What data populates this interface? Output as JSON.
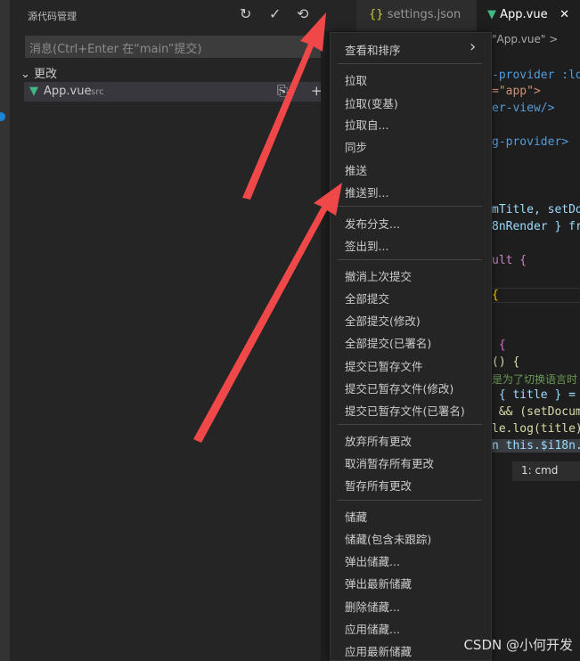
{
  "sidebar": {
    "title": "源代码管理",
    "message_placeholder": "消息(Ctrl+Enter 在“main”提交)",
    "changes_label": "更改",
    "file": {
      "name": "App.vue",
      "dir": "src"
    }
  },
  "tabs": [
    {
      "label": "settings.json",
      "icon": "{}"
    },
    {
      "label": "App.vue",
      "close": "✕"
    }
  ],
  "editor": {
    "breadcrumb": "\"App.vue\" >",
    "lines": [
      "-provider :lo",
      "=\"app\">",
      "er-view/>",
      "g-provider>",
      "mTitle, setDo",
      "8nRender } fr",
      "ult {",
      "{",
      " {",
      "() {",
      "是为了切换语言时",
      " { title } =",
      " && (setDocum",
      "le.log(title)",
      "n this.$i18n."
    ]
  },
  "terminal": {
    "label": "1: cmd"
  },
  "menu": {
    "groups": [
      [
        "查看和排序"
      ],
      [
        "拉取",
        "拉取(变基)",
        "拉取自...",
        "同步",
        "推送",
        "推送到..."
      ],
      [
        "发布分支...",
        "签出到..."
      ],
      [
        "撤消上次提交",
        "全部提交",
        "全部提交(修改)",
        "全部提交(已署名)",
        "提交已暂存文件",
        "提交已暂存文件(修改)",
        "提交已暂存文件(已署名)"
      ],
      [
        "放弃所有更改",
        "取消暂存所有更改",
        "暂存所有更改"
      ],
      [
        "储藏",
        "储藏(包含未跟踪)",
        "弹出储藏...",
        "弹出最新储藏",
        "删除储藏...",
        "应用储藏...",
        "应用最新储藏"
      ]
    ]
  },
  "watermark": "CSDN @小何开发",
  "colors": {
    "accent": "#1a85d6",
    "vue": "#41b883",
    "arrow": "#f04848"
  }
}
